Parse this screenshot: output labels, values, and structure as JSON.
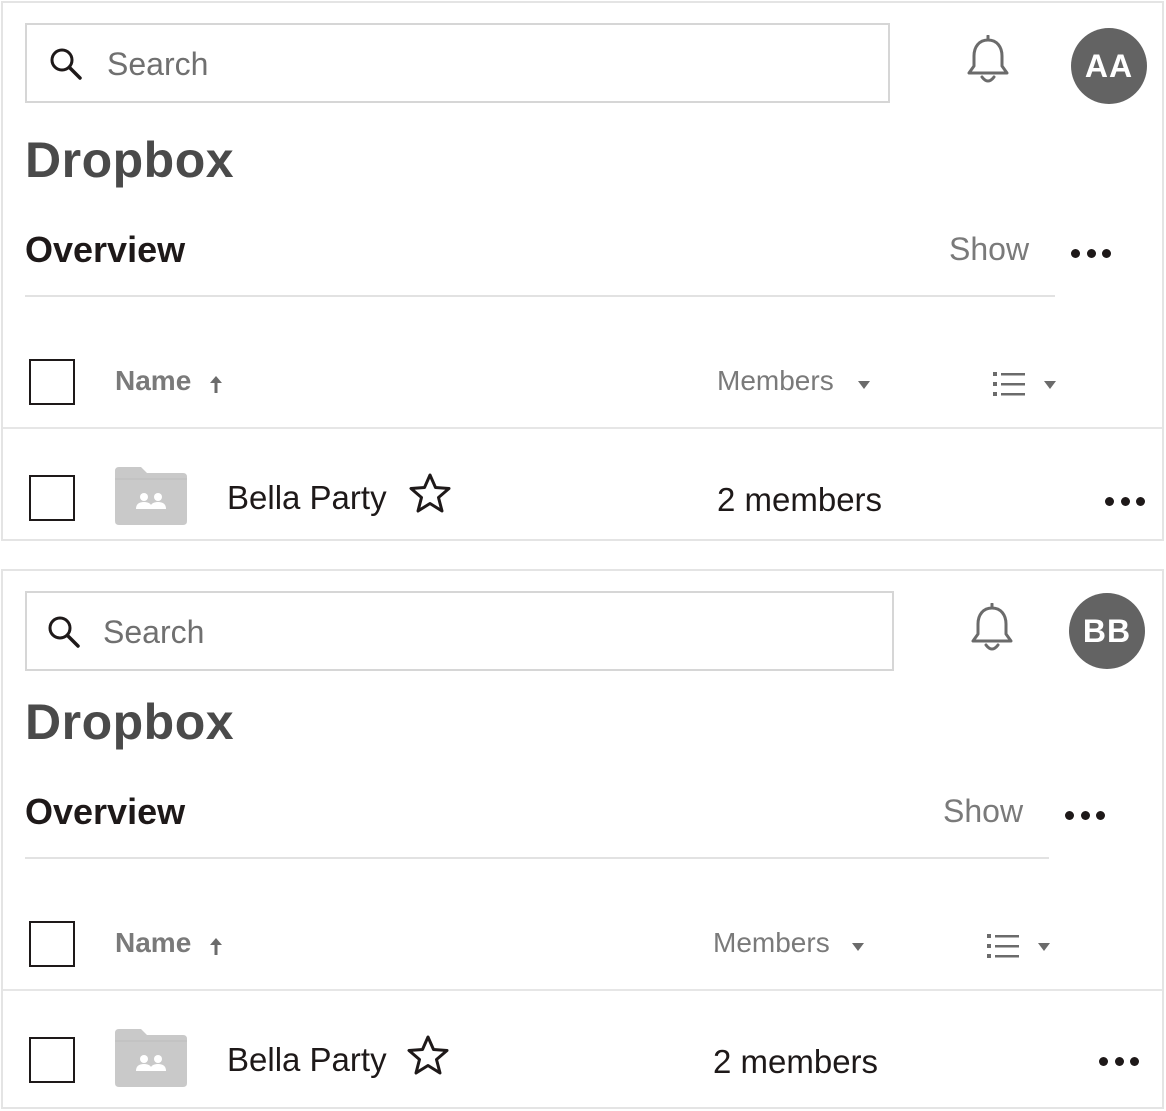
{
  "panels": [
    {
      "search": {
        "placeholder": "Search"
      },
      "avatar_initials": "AA",
      "app_title": "Dropbox",
      "section_title": "Overview",
      "show_label": "Show",
      "columns": {
        "name": "Name",
        "members": "Members"
      },
      "rows": [
        {
          "name": "Bella Party",
          "members": "2 members"
        }
      ]
    },
    {
      "search": {
        "placeholder": "Search"
      },
      "avatar_initials": "BB",
      "app_title": "Dropbox",
      "section_title": "Overview",
      "show_label": "Show",
      "columns": {
        "name": "Name",
        "members": "Members"
      },
      "rows": [
        {
          "name": "Bella Party",
          "members": "2 members"
        }
      ]
    }
  ],
  "icons": [
    "search-icon",
    "bell-icon",
    "more-icon",
    "sort-up-icon",
    "caret-down-icon",
    "list-view-icon",
    "shared-folder-icon",
    "star-icon"
  ],
  "colors": {
    "avatar_bg": "#636363",
    "text": "#1e1919",
    "muted": "#7a7a7a",
    "border": "#d6d6d6",
    "folder": "#c9c9c9"
  }
}
